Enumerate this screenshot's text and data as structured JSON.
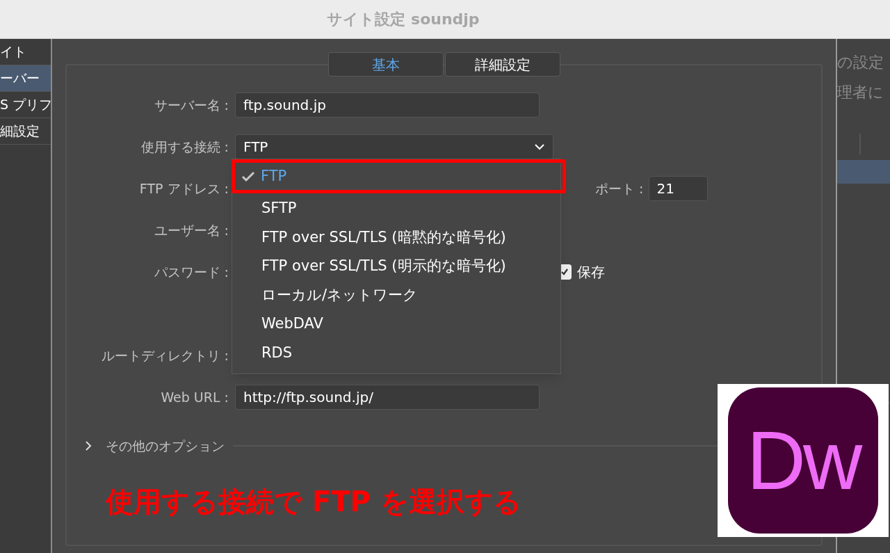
{
  "window": {
    "title": "サイト設定 soundjp"
  },
  "sidebar": {
    "items": [
      {
        "label": "イト",
        "selected": false
      },
      {
        "label": "ーバー",
        "selected": true
      },
      {
        "label": "S プリフ",
        "selected": false
      },
      {
        "label": "細設定",
        "selected": false
      }
    ]
  },
  "tabs": [
    {
      "label": "基本",
      "selected": true
    },
    {
      "label": "詳細設定",
      "selected": false
    }
  ],
  "form": {
    "rows": [
      {
        "kind": "field",
        "label": "サーバー名 :",
        "value": "ftp.sound.jp"
      },
      {
        "kind": "select",
        "label": "使用する接続 :",
        "value": "FTP"
      },
      {
        "kind": "covered",
        "label": "FTP アドレス :",
        "extra": {
          "kind": "port",
          "label": "ポート :",
          "value": "21"
        }
      },
      {
        "kind": "covered",
        "label": "ユーザー名 :"
      },
      {
        "kind": "covered",
        "label": "パスワード :",
        "extra": {
          "kind": "checkbox",
          "label": "保存",
          "checked": true
        }
      },
      {
        "kind": "blank"
      },
      {
        "kind": "covered",
        "label": "ルートディレクトリ :"
      },
      {
        "kind": "field",
        "label": "Web URL :",
        "value": "http://ftp.sound.jp/"
      }
    ],
    "more_options": {
      "label": "その他のオプション",
      "expanded": false
    }
  },
  "dropdown": {
    "options": [
      {
        "label": "FTP",
        "selected": true,
        "highlighted": true
      },
      {
        "label": "SFTP",
        "selected": false,
        "highlighted": false
      },
      {
        "label": "FTP over SSL/TLS (暗黙的な暗号化)",
        "selected": false,
        "highlighted": false
      },
      {
        "label": "FTP over SSL/TLS (明示的な暗号化)",
        "selected": false,
        "highlighted": false
      },
      {
        "label": "ローカル/ネットワーク",
        "selected": false,
        "highlighted": false
      },
      {
        "label": "WebDAV",
        "selected": false,
        "highlighted": false
      },
      {
        "label": "RDS",
        "selected": false,
        "highlighted": false
      }
    ]
  },
  "right_panel": {
    "lines": [
      "の設定",
      "理者に"
    ]
  },
  "annotation": {
    "caption": "使用する接続で FTP を選択する"
  },
  "logo": {
    "text": "Dw"
  }
}
